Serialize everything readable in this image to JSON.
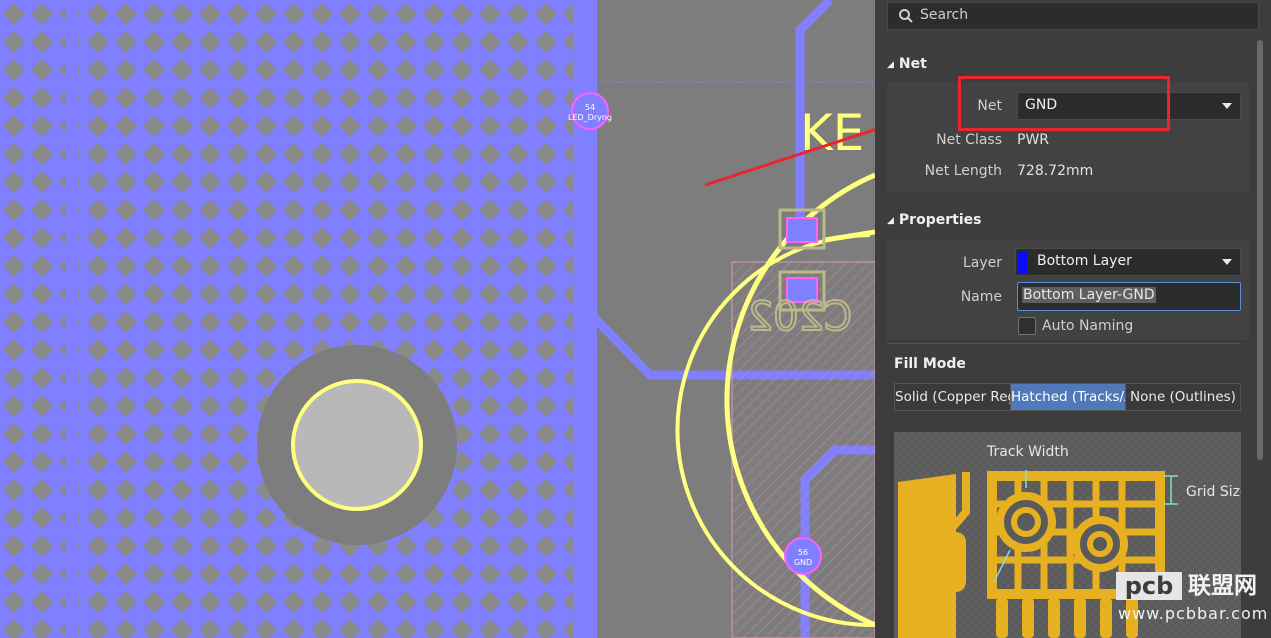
{
  "canvas": {
    "silk_text_ke": "KE",
    "silk_text_c202": "C202",
    "pad_top_number": "54",
    "pad_top_net": "LED_Dryng",
    "pad_bottom_number": "56",
    "pad_bottom_net": "GND"
  },
  "search": {
    "placeholder": "Search"
  },
  "net_section": {
    "title": "Net",
    "net_label": "Net",
    "net_value": "GND",
    "net_class_label": "Net Class",
    "net_class_value": "PWR",
    "net_length_label": "Net Length",
    "net_length_value": "728.72mm"
  },
  "properties_section": {
    "title": "Properties",
    "layer_label": "Layer",
    "layer_value": "Bottom Layer",
    "layer_color": "#0a0aff",
    "name_label": "Name",
    "name_value": "Bottom Layer-GND",
    "auto_naming_label": "Auto Naming"
  },
  "fill_mode": {
    "title": "Fill Mode",
    "options": [
      "Solid (Copper Regi",
      "Hatched (Tracks/A",
      "None (Outlines)"
    ],
    "selected": "Hatched (Tracks/A"
  },
  "preview": {
    "track_width_label": "Track Width",
    "grid_size_label": "Grid Size"
  },
  "watermark": {
    "brand": "pcb",
    "cn": "联盟网",
    "url": "www.pcbbar.com"
  },
  "colors": {
    "copper": "#8080ff",
    "silk": "#ffff80",
    "highlight": "#e8262c",
    "accent": "#4f79b9"
  }
}
